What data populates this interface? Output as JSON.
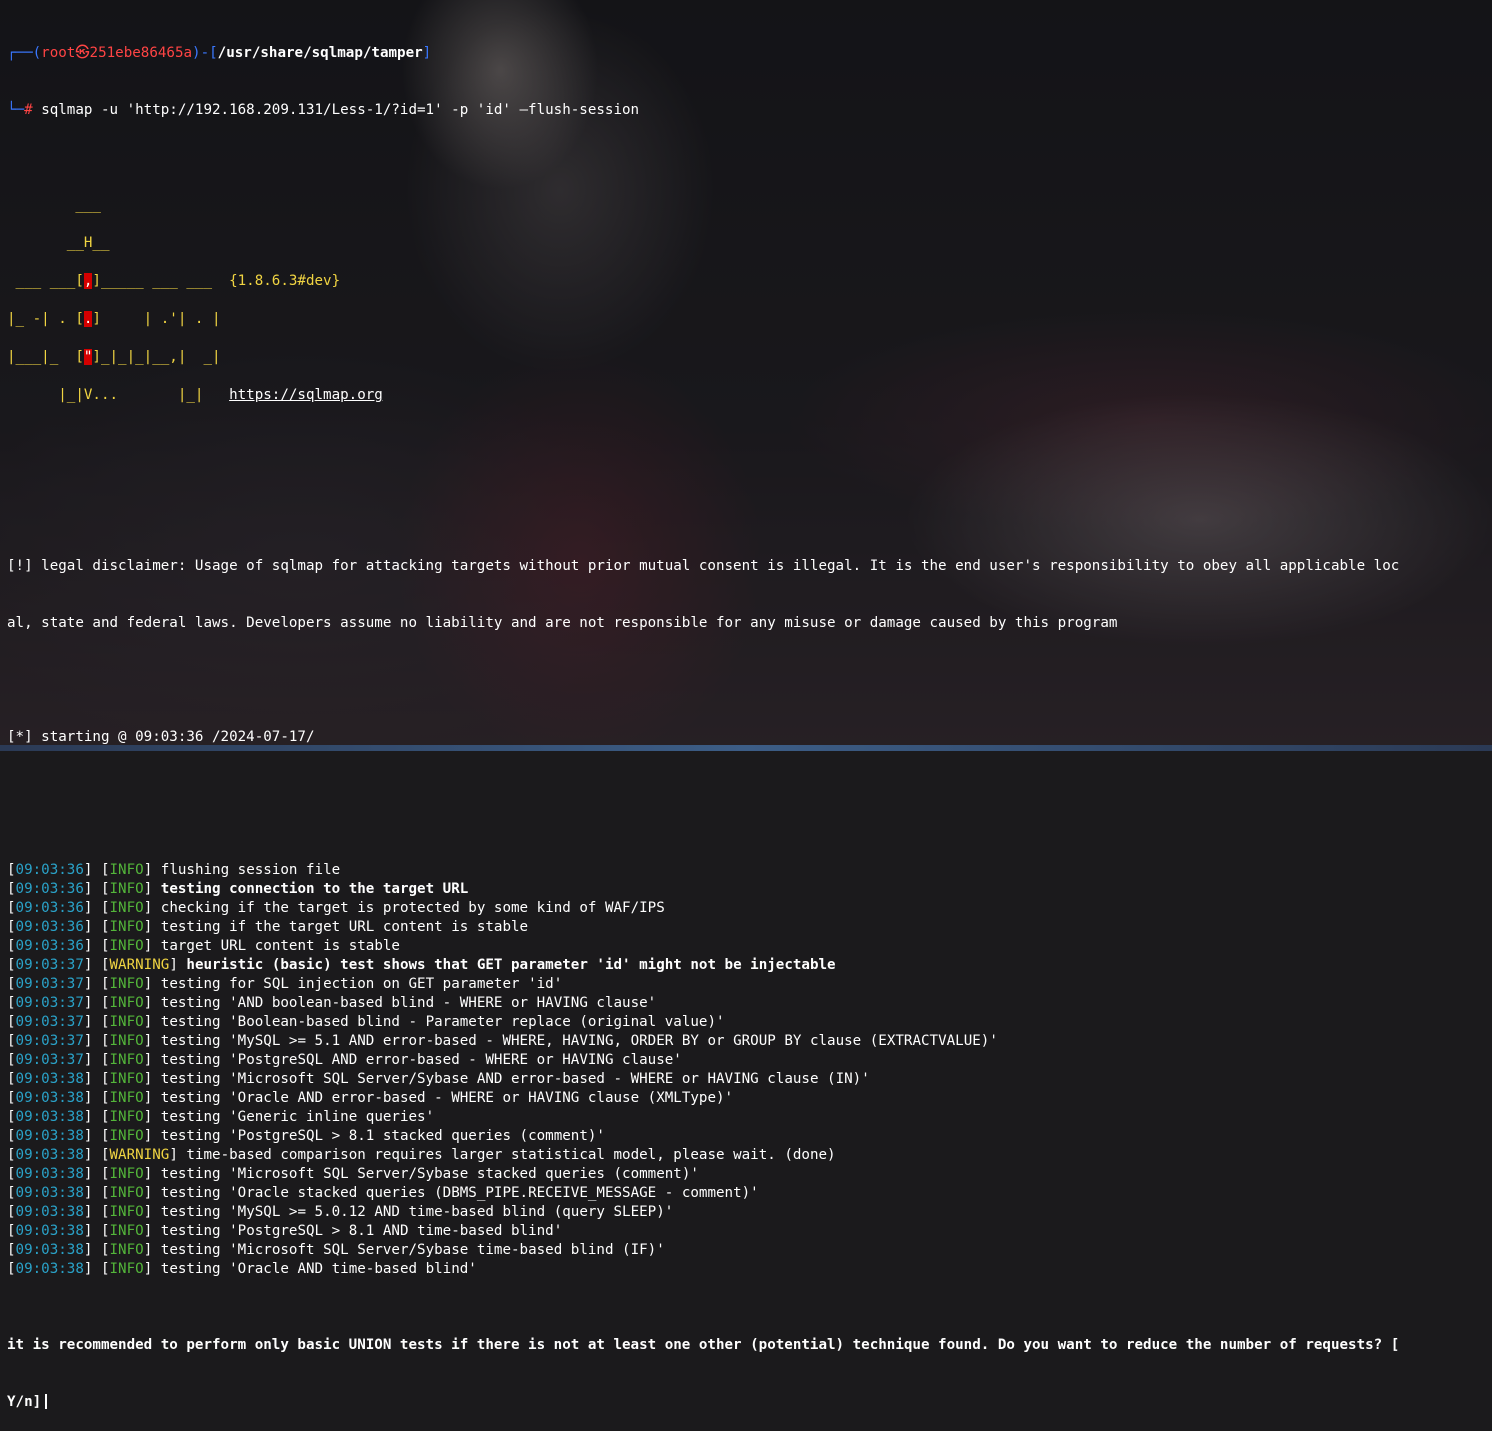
{
  "prompt": {
    "user_host": "root㉿251ebe86465a",
    "path": "/usr/share/sqlmap/tamper",
    "symbol": "#",
    "command": "sqlmap -u 'http://192.168.209.131/Less-1/?id=1' -p 'id' —flush-session"
  },
  "banner": {
    "version": "{1.8.6.3#dev}",
    "url": "https://sqlmap.org"
  },
  "disclaimer": {
    "line1": "[!] legal disclaimer: Usage of sqlmap for attacking targets without prior mutual consent is illegal. It is the end user's responsibility to obey all applicable loc",
    "line2": "al, state and federal laws. Developers assume no liability and are not responsible for any misuse or damage caused by this program"
  },
  "starting": "[*] starting @ 09:03:36 /2024-07-17/",
  "log": [
    {
      "time": "09:03:36",
      "level": "INFO",
      "msg": "flushing session file",
      "bright": false
    },
    {
      "time": "09:03:36",
      "level": "INFO",
      "msg": "testing connection to the target URL",
      "bright": true
    },
    {
      "time": "09:03:36",
      "level": "INFO",
      "msg": "checking if the target is protected by some kind of WAF/IPS",
      "bright": false
    },
    {
      "time": "09:03:36",
      "level": "INFO",
      "msg": "testing if the target URL content is stable",
      "bright": false
    },
    {
      "time": "09:03:36",
      "level": "INFO",
      "msg": "target URL content is stable",
      "bright": false
    },
    {
      "time": "09:03:37",
      "level": "WARNING",
      "msg": "heuristic (basic) test shows that GET parameter 'id' might not be injectable",
      "bright": true
    },
    {
      "time": "09:03:37",
      "level": "INFO",
      "msg": "testing for SQL injection on GET parameter 'id'",
      "bright": false
    },
    {
      "time": "09:03:37",
      "level": "INFO",
      "msg": "testing 'AND boolean-based blind - WHERE or HAVING clause'",
      "bright": false
    },
    {
      "time": "09:03:37",
      "level": "INFO",
      "msg": "testing 'Boolean-based blind - Parameter replace (original value)'",
      "bright": false
    },
    {
      "time": "09:03:37",
      "level": "INFO",
      "msg": "testing 'MySQL >= 5.1 AND error-based - WHERE, HAVING, ORDER BY or GROUP BY clause (EXTRACTVALUE)'",
      "bright": false
    },
    {
      "time": "09:03:37",
      "level": "INFO",
      "msg": "testing 'PostgreSQL AND error-based - WHERE or HAVING clause'",
      "bright": false
    },
    {
      "time": "09:03:38",
      "level": "INFO",
      "msg": "testing 'Microsoft SQL Server/Sybase AND error-based - WHERE or HAVING clause (IN)'",
      "bright": false
    },
    {
      "time": "09:03:38",
      "level": "INFO",
      "msg": "testing 'Oracle AND error-based - WHERE or HAVING clause (XMLType)'",
      "bright": false
    },
    {
      "time": "09:03:38",
      "level": "INFO",
      "msg": "testing 'Generic inline queries'",
      "bright": false
    },
    {
      "time": "09:03:38",
      "level": "INFO",
      "msg": "testing 'PostgreSQL > 8.1 stacked queries (comment)'",
      "bright": false
    },
    {
      "time": "09:03:38",
      "level": "WARNING",
      "msg": "time-based comparison requires larger statistical model, please wait. (done)",
      "bright": false
    },
    {
      "time": "09:03:38",
      "level": "INFO",
      "msg": "testing 'Microsoft SQL Server/Sybase stacked queries (comment)'",
      "bright": false
    },
    {
      "time": "09:03:38",
      "level": "INFO",
      "msg": "testing 'Oracle stacked queries (DBMS_PIPE.RECEIVE_MESSAGE - comment)'",
      "bright": false
    },
    {
      "time": "09:03:38",
      "level": "INFO",
      "msg": "testing 'MySQL >= 5.0.12 AND time-based blind (query SLEEP)'",
      "bright": false
    },
    {
      "time": "09:03:38",
      "level": "INFO",
      "msg": "testing 'PostgreSQL > 8.1 AND time-based blind'",
      "bright": false
    },
    {
      "time": "09:03:38",
      "level": "INFO",
      "msg": "testing 'Microsoft SQL Server/Sybase time-based blind (IF)'",
      "bright": false
    },
    {
      "time": "09:03:38",
      "level": "INFO",
      "msg": "testing 'Oracle AND time-based blind'",
      "bright": false
    }
  ],
  "question": {
    "line1": "it is recommended to perform only basic UNION tests if there is not at least one other (potential) technique found. Do you want to reduce the number of requests? [",
    "line2": "Y/n]"
  }
}
